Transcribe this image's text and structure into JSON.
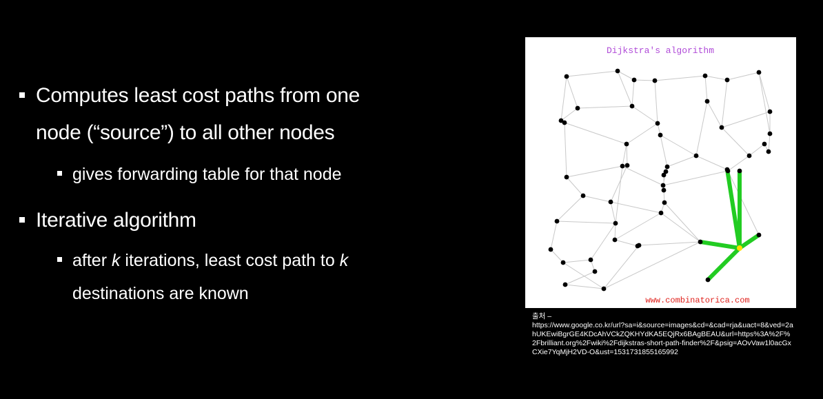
{
  "bullets": {
    "item1": {
      "line1": "Computes least cost paths from one",
      "line2": "node (“source”) to all other nodes",
      "sub": "gives forwarding table for that node"
    },
    "item2": {
      "title": "Iterative algorithm",
      "sub_pre": "after ",
      "sub_k1": "k",
      "sub_mid": " iterations, least cost path to ",
      "sub_k2": "k",
      "sub_line2": "destinations are known"
    }
  },
  "figure": {
    "title": "Dijkstra's algorithm",
    "credit": "www.combinatorica.com",
    "colors": {
      "title": "#b04bd8",
      "credit": "#e0201b",
      "path": "#22cc22",
      "source": "#ffe000"
    }
  },
  "caption": {
    "label": "출처 –",
    "url": "https://www.google.co.kr/url?sa=i&source=images&cd=&cad=rja&uact=8&ved=2ahUKEwiBgrGE4KDcAhVCkZQKHYdKA5EQjRx6BAgBEAU&url=https%3A%2F%2Fbrilliant.org%2Fwiki%2Fdijkstras-short-path-finder%2F&psig=AOvVaw1l0acGxCXie7YqMjH2VD-O&ust=1531731855165992"
  }
}
